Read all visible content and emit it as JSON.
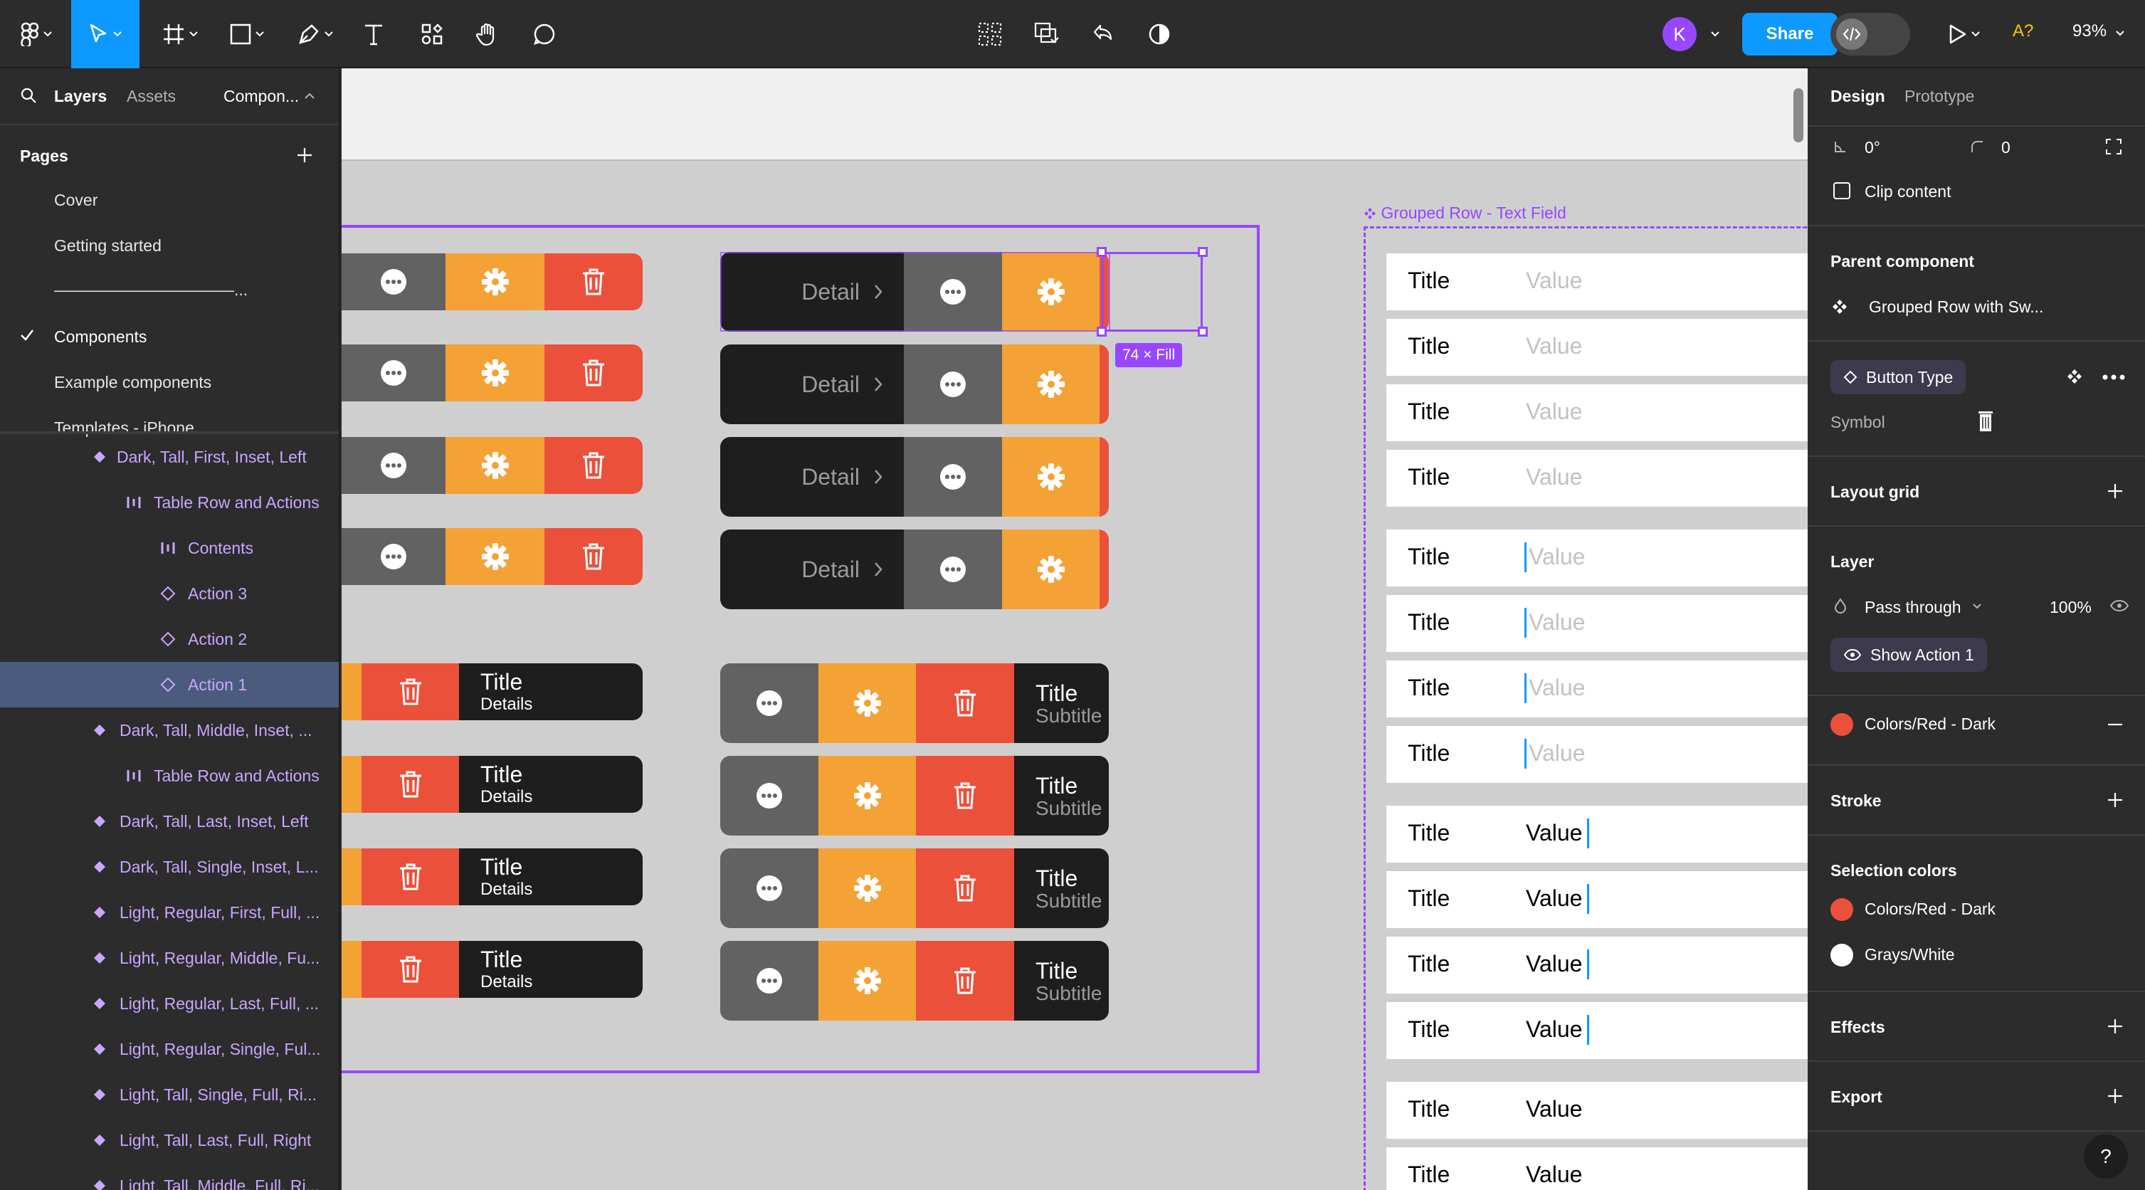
{
  "toolbar": {
    "share_label": "Share",
    "avatar_initial": "K",
    "a11y_label": "A?",
    "zoom_label": "93%"
  },
  "left_panel": {
    "tabs": {
      "layers": "Layers",
      "assets": "Assets",
      "components": "Compon..."
    },
    "pages_heading": "Pages",
    "pages": [
      "Cover",
      "Getting started",
      "———————————...",
      "Components",
      "Example components",
      "Templates - iPhone"
    ],
    "layers": [
      "Dark, Tall, First, Inset, Left",
      "Table Row and Actions",
      "Contents",
      "Action 3",
      "Action 2",
      "Action 1",
      "Dark, Tall, Middle, Inset, ...",
      "Table Row and Actions",
      "Dark, Tall, Last, Inset, Left",
      "Dark, Tall, Single, Inset, L...",
      "Light, Regular, First, Full, ...",
      "Light, Regular, Middle, Fu...",
      "Light, Regular, Last, Full, ...",
      "Light, Regular, Single, Ful...",
      "Light, Tall, Single, Full, Ri...",
      "Light, Tall, Last, Full, Right",
      "Light, Tall, Middle, Full, Ri..."
    ]
  },
  "canvas": {
    "frame2_label": "Grouped Row - Text Field",
    "selection_badge": "74 × Fill",
    "detail_label": "Detail",
    "title_label": "Title",
    "details_label": "Details",
    "subtitle_label": "Subtitle",
    "text_fields": [
      {
        "title": "Title",
        "value": "Value"
      },
      {
        "title": "Title",
        "value": "Value"
      },
      {
        "title": "Title",
        "value": "Value"
      },
      {
        "title": "Title",
        "value": "Value"
      },
      {
        "title": "Title",
        "value": "Value"
      },
      {
        "title": "Title",
        "value": "Value"
      },
      {
        "title": "Title",
        "value": "Value"
      },
      {
        "title": "Title",
        "value": "Value"
      },
      {
        "title": "Title",
        "value": "Value"
      },
      {
        "title": "Title",
        "value": "Value"
      },
      {
        "title": "Title",
        "value": "Value"
      },
      {
        "title": "Title",
        "value": "Value"
      },
      {
        "title": "Title",
        "value": "Value"
      },
      {
        "title": "Title",
        "value": "Value"
      }
    ]
  },
  "right_panel": {
    "tabs": {
      "design": "Design",
      "prototype": "Prototype"
    },
    "rotation": "0°",
    "radius": "0",
    "clip_content": "Clip content",
    "parent_component_heading": "Parent component",
    "parent_component_name": "Grouped Row with Sw...",
    "button_type": "Button Type",
    "symbol_label": "Symbol",
    "layout_grid": "Layout grid",
    "layer_heading": "Layer",
    "blend_mode": "Pass through",
    "opacity": "100%",
    "show_action": "Show Action 1",
    "fill_style": "Colors/Red - Dark",
    "stroke": "Stroke",
    "selection_colors": "Selection colors",
    "sel_color_1": "Colors/Red - Dark",
    "sel_color_2": "Grays/White",
    "effects": "Effects",
    "export": "Export",
    "help": "?"
  },
  "colors": {
    "accent": "#0d99ff",
    "component_purple": "#9747ff",
    "red_dark": "#eb503b",
    "orange": "#f4a236",
    "gray": "#626262",
    "dark": "#1e1e1e"
  }
}
